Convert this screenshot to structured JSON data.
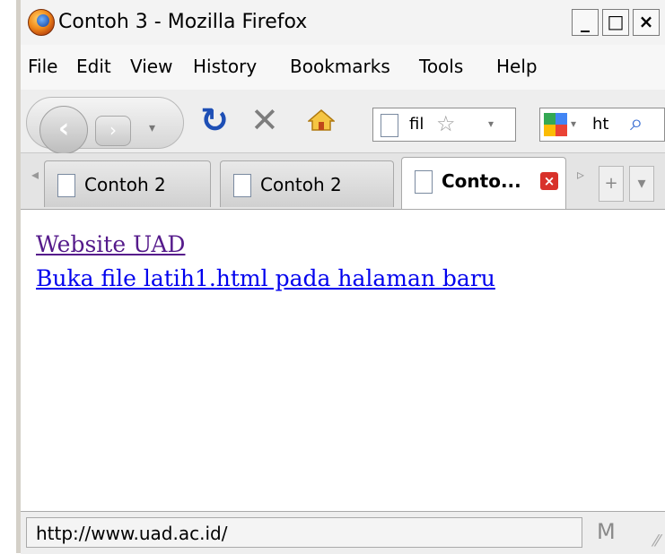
{
  "window": {
    "title": "Contoh 3 - Mozilla Firefox",
    "buttons": {
      "minimize": "_",
      "maximize": "□",
      "close": "×"
    }
  },
  "menu": [
    "File",
    "Edit",
    "View",
    "History",
    "Bookmarks",
    "Tools",
    "Help"
  ],
  "toolbar": {
    "url_text": "fil",
    "search_text": "ht"
  },
  "tabs": [
    {
      "label": "Contoh 2",
      "active": false
    },
    {
      "label": "Contoh 2",
      "active": false
    },
    {
      "label": "Conto...",
      "active": true
    }
  ],
  "content": {
    "links": [
      {
        "text": "Website UAD",
        "state": "visited"
      },
      {
        "text": "Buka file latih1.html pada halaman baru",
        "state": "unvisited"
      }
    ]
  },
  "status": {
    "text": "http://www.uad.ac.id/"
  },
  "colors": {
    "visited_link": "#551a8b",
    "link": "#0000ee",
    "close_tab": "#d8312a",
    "reload": "#1e4fb5"
  }
}
